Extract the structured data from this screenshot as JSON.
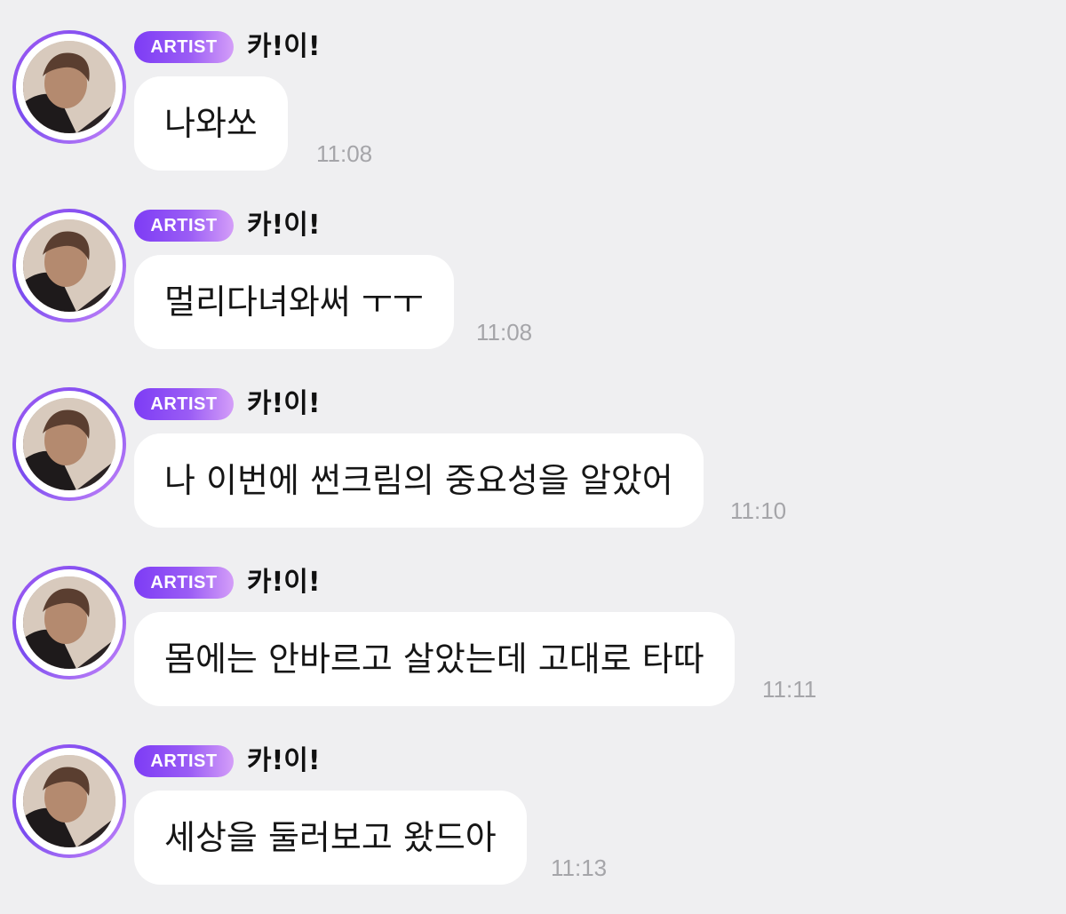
{
  "messages": [
    {
      "badge": "ARTIST",
      "name": "카!이!",
      "text": "나와쏘",
      "time": "11:08"
    },
    {
      "badge": "ARTIST",
      "name": "카!이!",
      "text": "멀리다녀와써 ㅜㅜ",
      "time": "11:08"
    },
    {
      "badge": "ARTIST",
      "name": "카!이!",
      "text": "나 이번에 썬크림의 중요성을 알았어",
      "time": "11:10"
    },
    {
      "badge": "ARTIST",
      "name": "카!이!",
      "text": "몸에는 안바르고 살았는데 고대로 타따",
      "time": "11:11"
    },
    {
      "badge": "ARTIST",
      "name": "카!이!",
      "text": "세상을 둘러보고 왔드아",
      "time": "11:13"
    }
  ],
  "colors": {
    "background": "#efeff1",
    "bubble": "#ffffff",
    "badge_start": "#7d3cf5",
    "badge_end": "#d49ef8",
    "avatar_ring": "#a25cf2",
    "time_text": "#a5a5a9"
  },
  "icons": {
    "avatar": "profile-photo"
  }
}
